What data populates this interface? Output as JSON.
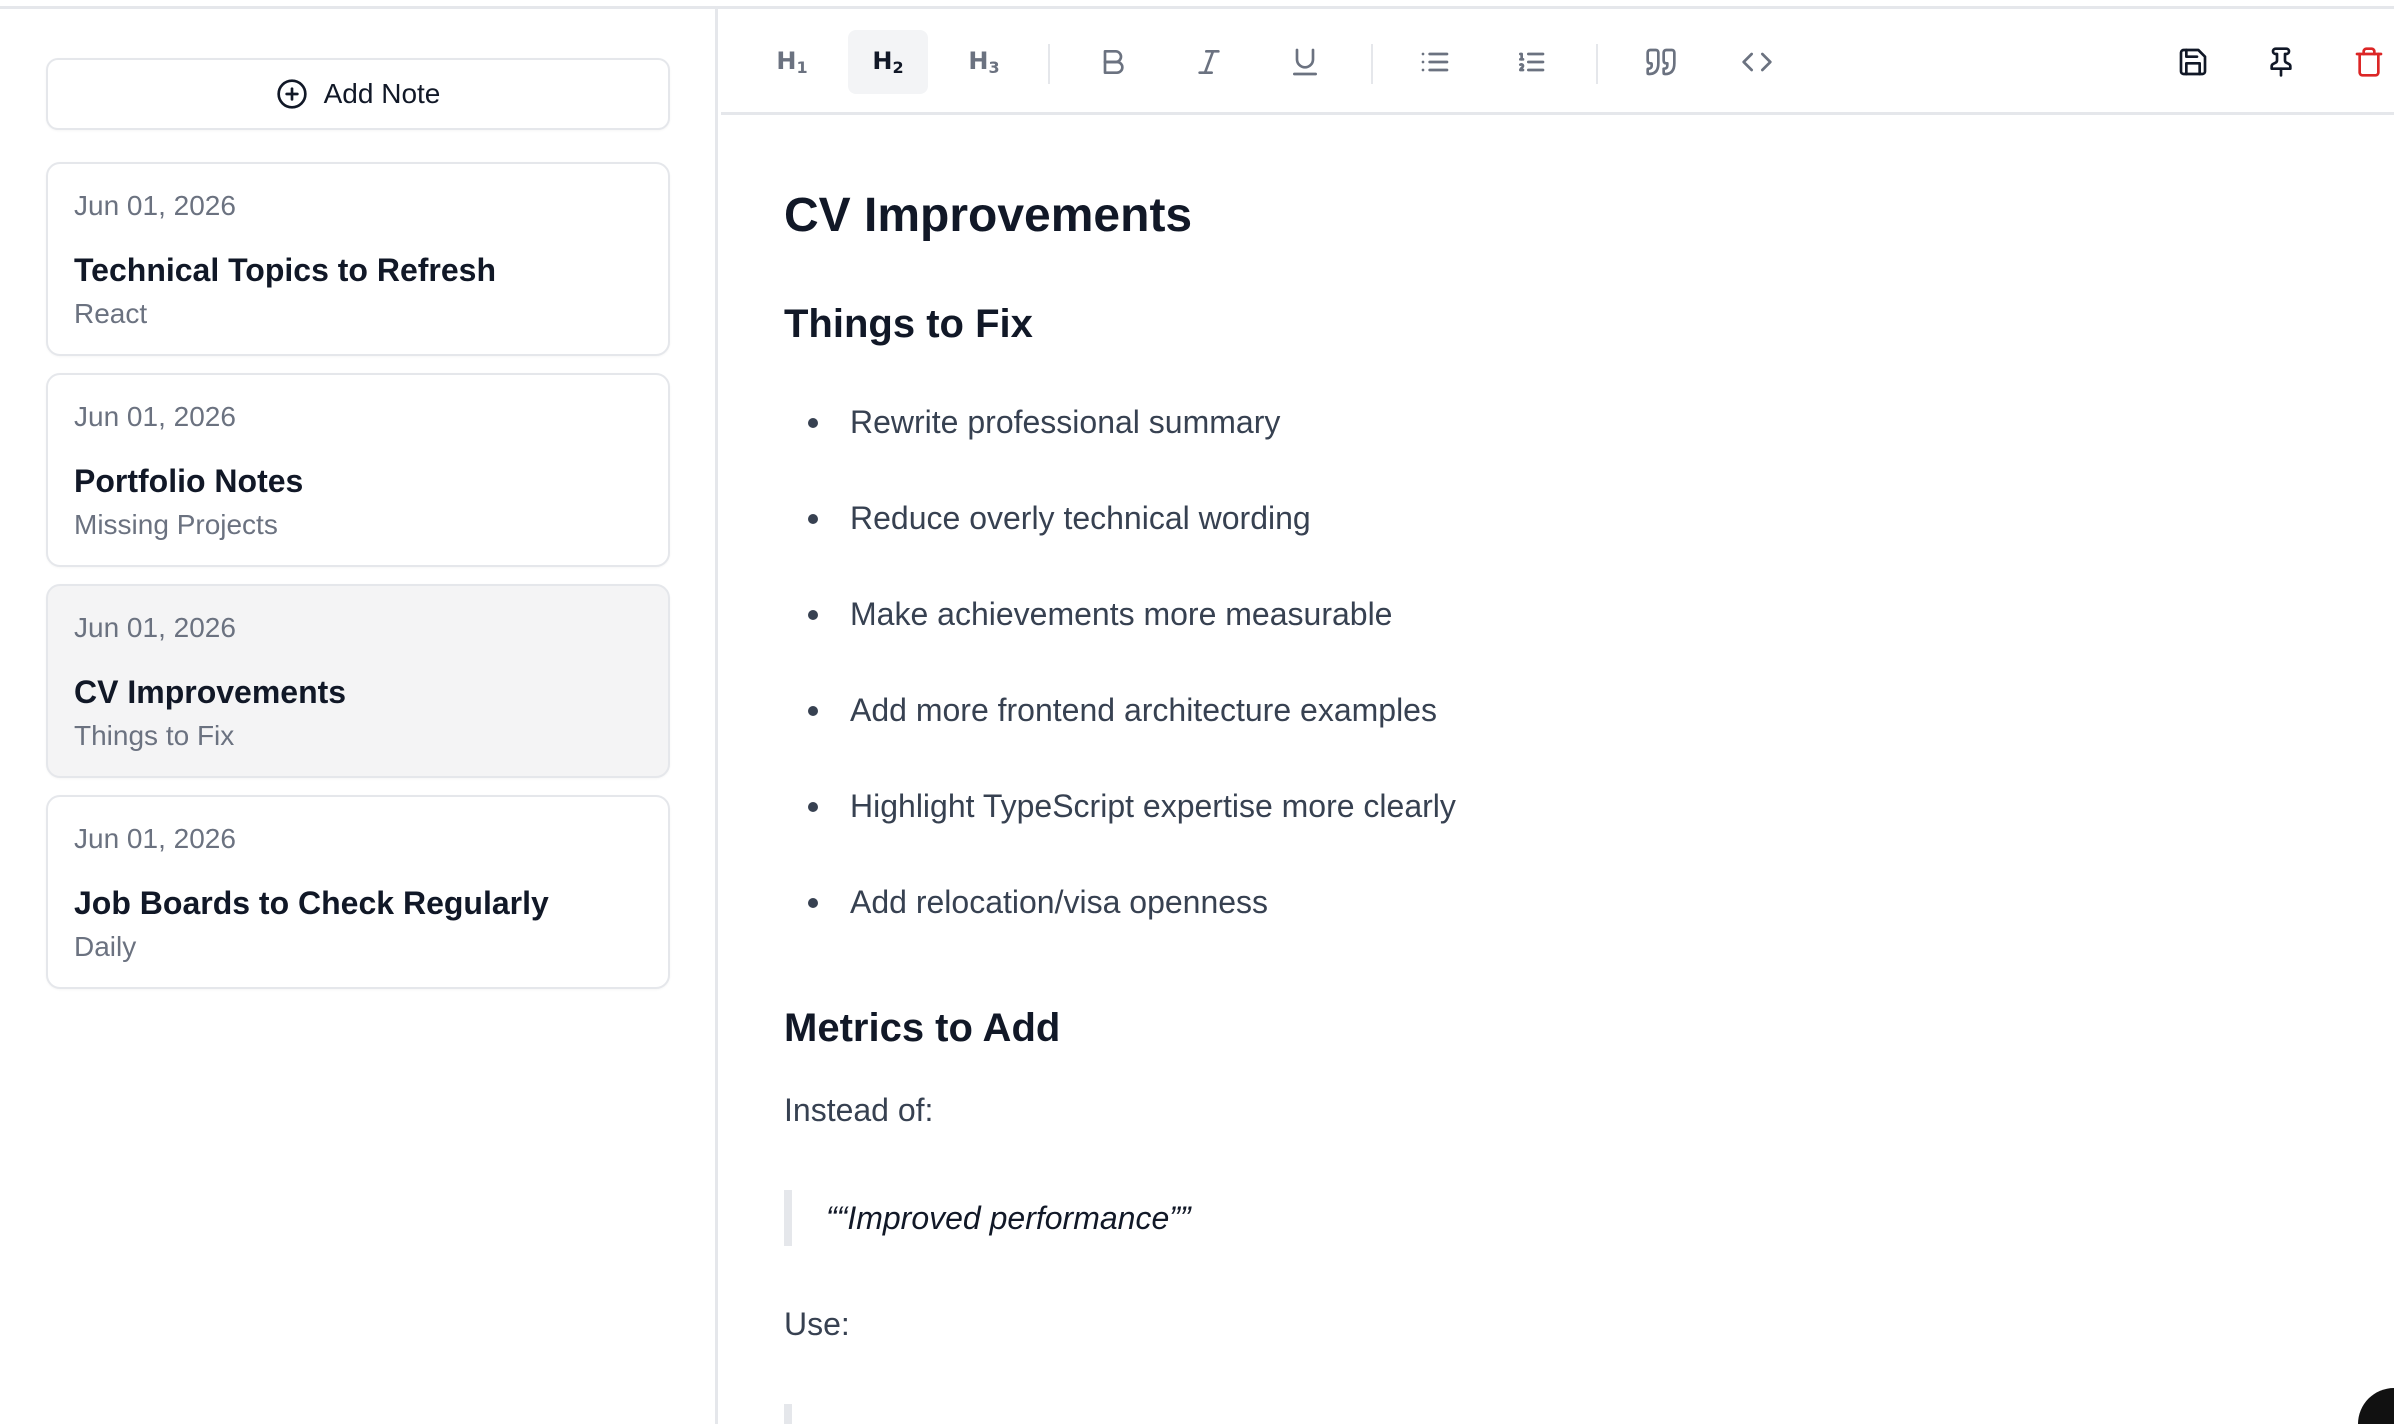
{
  "sidebar": {
    "add_note_label": "Add Note",
    "notes": [
      {
        "date": "Jun 01, 2026",
        "title": "Technical Topics to Refresh",
        "subtitle": "React"
      },
      {
        "date": "Jun 01, 2026",
        "title": "Portfolio Notes",
        "subtitle": "Missing Projects"
      },
      {
        "date": "Jun 01, 2026",
        "title": "CV Improvements",
        "subtitle": "Things to Fix",
        "active": true
      },
      {
        "date": "Jun 01, 2026",
        "title": "Job Boards to Check Regularly",
        "subtitle": "Daily"
      }
    ]
  },
  "toolbar": {
    "h1": "H",
    "h1_level": "1",
    "h2": "H",
    "h2_level": "2",
    "h3": "H",
    "h3_level": "3",
    "active_tool": "h2",
    "icons": [
      "bold-icon",
      "italic-icon",
      "underline-icon",
      "bullet-list-icon",
      "ordered-list-icon",
      "quote-icon",
      "code-icon",
      "save-icon",
      "pin-icon",
      "trash-icon"
    ],
    "delete_color": "#dc2626"
  },
  "document": {
    "title": "CV Improvements",
    "section1_heading": "Things to Fix",
    "bullets": [
      "Rewrite professional summary",
      "Reduce overly technical wording",
      "Make achievements more measurable",
      "Add more frontend architecture examples",
      "Highlight TypeScript expertise more clearly",
      "Add relocation/visa openness"
    ],
    "section2_heading": "Metrics to Add",
    "instead_label": "Instead of:",
    "quote1": "““Improved performance””",
    "use_label": "Use:"
  }
}
